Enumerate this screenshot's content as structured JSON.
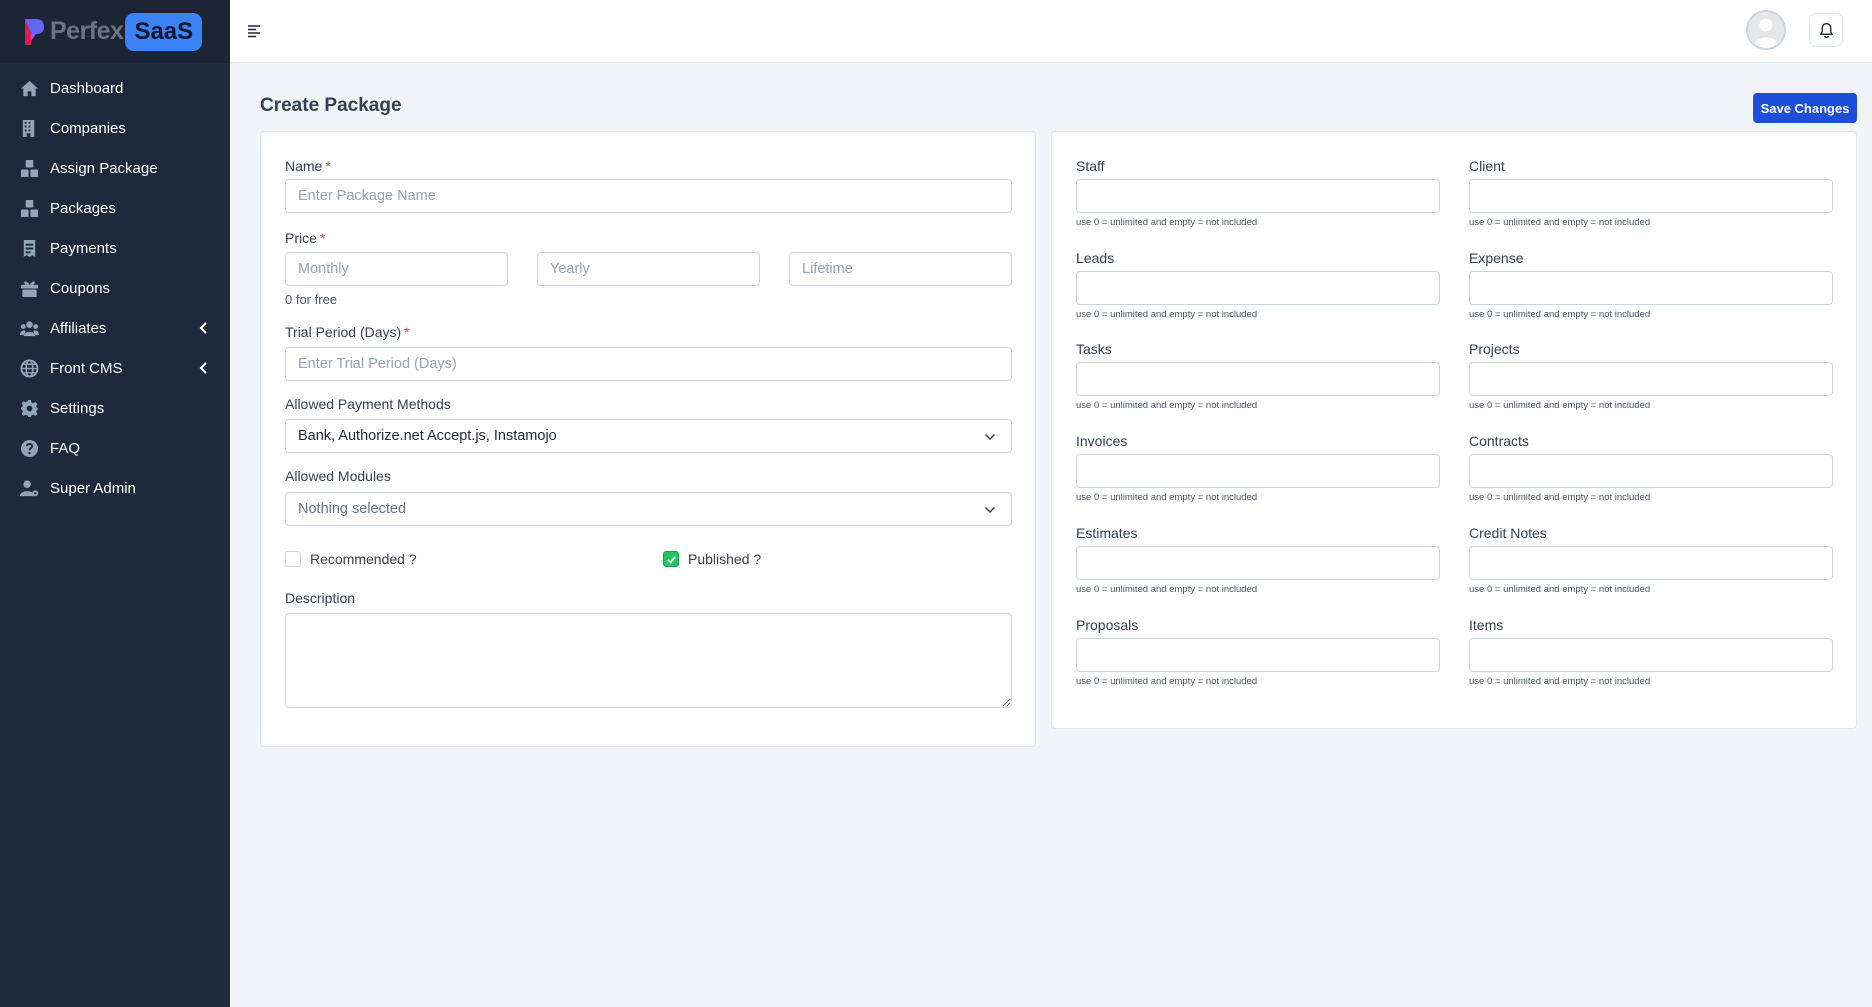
{
  "brand": {
    "name": "Perfex",
    "badge": "SaaS"
  },
  "sidebar": {
    "items": [
      {
        "label": "Dashboard",
        "icon": "home-icon"
      },
      {
        "label": "Companies",
        "icon": "building-icon"
      },
      {
        "label": "Assign Package",
        "icon": "boxes-icon"
      },
      {
        "label": "Packages",
        "icon": "boxes-icon"
      },
      {
        "label": "Payments",
        "icon": "receipt-icon"
      },
      {
        "label": "Coupons",
        "icon": "gift-icon"
      },
      {
        "label": "Affiliates",
        "icon": "users-icon",
        "expandable": true
      },
      {
        "label": "Front CMS",
        "icon": "globe-icon",
        "expandable": true
      },
      {
        "label": "Settings",
        "icon": "gear-icon"
      },
      {
        "label": "FAQ",
        "icon": "question-icon"
      },
      {
        "label": "Super Admin",
        "icon": "user-gear-icon"
      }
    ]
  },
  "page": {
    "title": "Create Package",
    "save_label": "Save Changes"
  },
  "form": {
    "name_label": "Name",
    "name_placeholder": "Enter Package Name",
    "price_label": "Price",
    "price_monthly_placeholder": "Monthly",
    "price_yearly_placeholder": "Yearly",
    "price_lifetime_placeholder": "Lifetime",
    "price_hint": "0 for free",
    "trial_label": "Trial Period (Days)",
    "trial_placeholder": "Enter Trial Period (Days)",
    "payment_label": "Allowed Payment Methods",
    "payment_value": "Bank, Authorize.net Accept.js, Instamojo",
    "modules_label": "Allowed Modules",
    "modules_value": "Nothing selected",
    "recommended_label": "Recommended ?",
    "recommended_checked": false,
    "published_label": "Published ?",
    "published_checked": true,
    "description_label": "Description",
    "required_mark": "*"
  },
  "limits": {
    "help": "use 0 = unlimited and empty = not included",
    "fields": [
      {
        "label": "Staff"
      },
      {
        "label": "Client"
      },
      {
        "label": "Leads"
      },
      {
        "label": "Expense"
      },
      {
        "label": "Tasks"
      },
      {
        "label": "Projects"
      },
      {
        "label": "Invoices"
      },
      {
        "label": "Contracts"
      },
      {
        "label": "Estimates"
      },
      {
        "label": "Credit Notes"
      },
      {
        "label": "Proposals"
      },
      {
        "label": "Items"
      }
    ]
  },
  "colors": {
    "sidebar": "#1e293b",
    "primary": "#1d4ed8",
    "brand_pill": "#3b82f6",
    "checked": "#22c55e"
  }
}
